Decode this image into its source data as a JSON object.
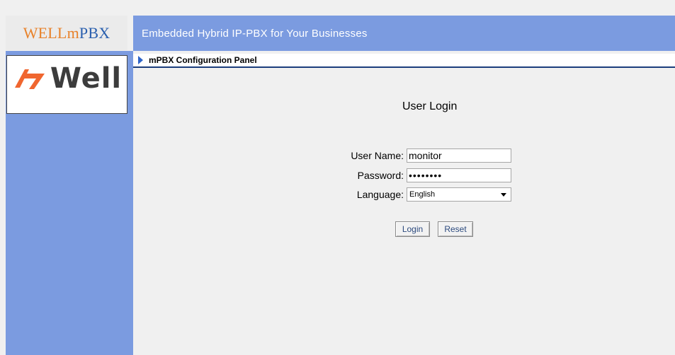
{
  "brand": {
    "well": "WELL",
    "m": "m",
    "pbx": "PBX",
    "tagline": "Embedded Hybrid IP-PBX for Your Businesses",
    "logo_word": "Well"
  },
  "panel": {
    "title": "mPBX Configuration Panel"
  },
  "login": {
    "title": "User Login",
    "username_label": "User Name:",
    "username_value": "monitor",
    "password_label": "Password:",
    "password_value": "monitor1",
    "language_label": "Language:",
    "language_value": "English",
    "login_button": "Login",
    "reset_button": "Reset"
  },
  "colors": {
    "header_blue": "#7b9be0",
    "brand_orange": "#e8822a",
    "brand_blue": "#2a5fae",
    "panel_border": "#1a3d7c"
  },
  "icons": {
    "panel_marker": "triangle-right-icon",
    "logo_mark": "well-logo-icon",
    "dropdown": "chevron-down-icon"
  }
}
